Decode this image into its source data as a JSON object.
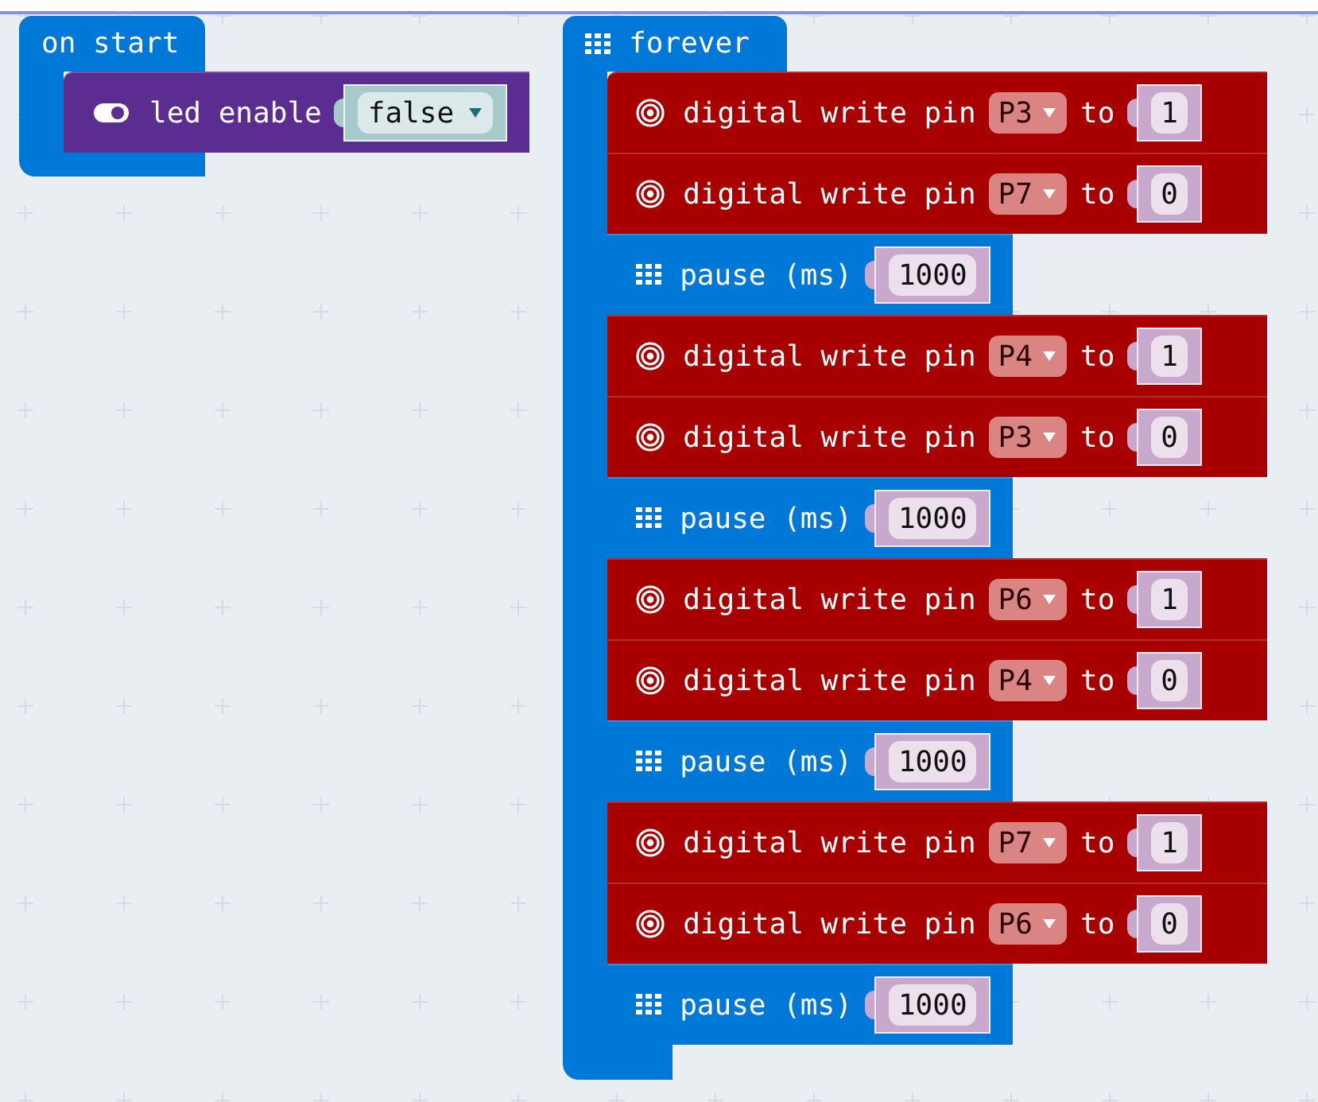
{
  "on_start": {
    "label": "on start",
    "statements": [
      {
        "kind": "led_enable",
        "label": "led enable",
        "value": "false"
      }
    ]
  },
  "forever": {
    "label": "forever",
    "statements": [
      {
        "kind": "digital_write",
        "label": "digital write pin",
        "pin": "P3",
        "to": "to",
        "value": "1"
      },
      {
        "kind": "digital_write",
        "label": "digital write pin",
        "pin": "P7",
        "to": "to",
        "value": "0"
      },
      {
        "kind": "pause",
        "label": "pause (ms)",
        "value": "1000"
      },
      {
        "kind": "digital_write",
        "label": "digital write pin",
        "pin": "P4",
        "to": "to",
        "value": "1"
      },
      {
        "kind": "digital_write",
        "label": "digital write pin",
        "pin": "P3",
        "to": "to",
        "value": "0"
      },
      {
        "kind": "pause",
        "label": "pause (ms)",
        "value": "1000"
      },
      {
        "kind": "digital_write",
        "label": "digital write pin",
        "pin": "P6",
        "to": "to",
        "value": "1"
      },
      {
        "kind": "digital_write",
        "label": "digital write pin",
        "pin": "P4",
        "to": "to",
        "value": "0"
      },
      {
        "kind": "pause",
        "label": "pause (ms)",
        "value": "1000"
      },
      {
        "kind": "digital_write",
        "label": "digital write pin",
        "pin": "P7",
        "to": "to",
        "value": "1"
      },
      {
        "kind": "digital_write",
        "label": "digital write pin",
        "pin": "P6",
        "to": "to",
        "value": "0"
      },
      {
        "kind": "pause",
        "label": "pause (ms)",
        "value": "1000"
      }
    ]
  }
}
